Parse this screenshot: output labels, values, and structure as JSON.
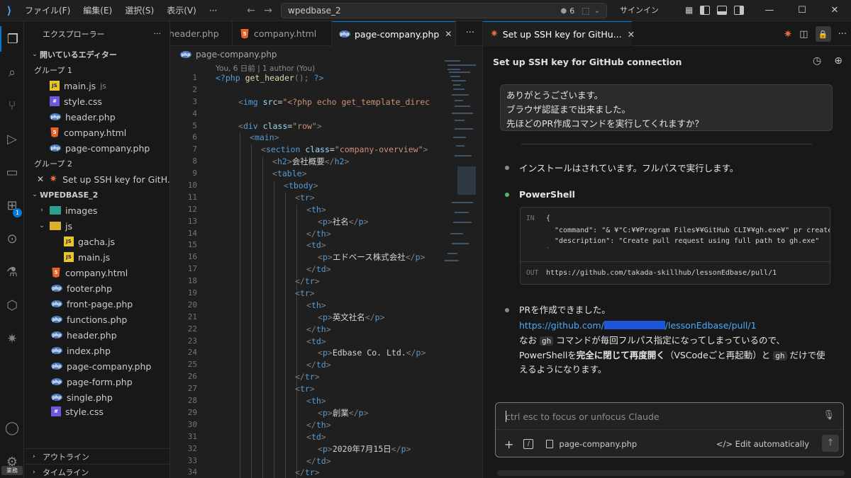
{
  "titlebar": {
    "menus": [
      "ファイル(F)",
      "編集(E)",
      "選択(S)",
      "表示(V)",
      "···"
    ],
    "search_text": "wpedbase_2",
    "badge_count": "6",
    "signin": "サインイン"
  },
  "activity": {
    "badge": "1",
    "account_label": "業務"
  },
  "sidebar": {
    "title": "エクスプローラー",
    "more": "···",
    "open_editors_label": "開いているエディター",
    "group1_label": "グループ 1",
    "group1": [
      {
        "name": "main.js",
        "extra": "js",
        "type": "js"
      },
      {
        "name": "style.css",
        "extra": "",
        "type": "css"
      },
      {
        "name": "header.php",
        "extra": "",
        "type": "php"
      },
      {
        "name": "company.html",
        "extra": "",
        "type": "html"
      },
      {
        "name": "page-company.php",
        "extra": "",
        "type": "php"
      }
    ],
    "group2_label": "グループ 2",
    "group2_item": "Set up SSH key for GitH...",
    "project_label": "WPEDBASE_2",
    "tree": [
      {
        "name": "images",
        "type": "folder"
      },
      {
        "name": "js",
        "type": "folder-js"
      },
      {
        "name": "gacha.js",
        "type": "js"
      },
      {
        "name": "main.js",
        "type": "js"
      },
      {
        "name": "company.html",
        "type": "html"
      },
      {
        "name": "footer.php",
        "type": "php"
      },
      {
        "name": "front-page.php",
        "type": "php"
      },
      {
        "name": "functions.php",
        "type": "php"
      },
      {
        "name": "header.php",
        "type": "php"
      },
      {
        "name": "index.php",
        "type": "php"
      },
      {
        "name": "page-company.php",
        "type": "php"
      },
      {
        "name": "page-form.php",
        "type": "php"
      },
      {
        "name": "single.php",
        "type": "php"
      },
      {
        "name": "style.css",
        "type": "css"
      }
    ],
    "outline_label": "アウトライン",
    "timeline_label": "タイムライン"
  },
  "editor": {
    "tabs": [
      "header.php",
      "company.html",
      "page-company.php"
    ],
    "breadcrumb": "page-company.php",
    "codelens": "You, 6 日前 | 1 author (You)",
    "line_numbers": [
      "1",
      "2",
      "3",
      "4",
      "5",
      "6",
      "7",
      "8",
      "9",
      "10",
      "11",
      "12",
      "13",
      "14",
      "15",
      "16",
      "17",
      "18",
      "19",
      "20",
      "21",
      "22",
      "23",
      "24",
      "25",
      "26",
      "27",
      "28",
      "29",
      "30",
      "31",
      "32",
      "33",
      "34"
    ],
    "code_text": {
      "l1": "get_header",
      "l3a": "img",
      "l3b": "src",
      "l3c": "\"<?php echo get_template_direc",
      "l5a": "div",
      "l5b": "class",
      "l5c": "\"row\"",
      "l6": "main",
      "l7a": "section",
      "l7b": "class",
      "l7c": "\"company-overview\"",
      "l8": "会社概要",
      "l9": "table",
      "l10": "tbody",
      "l11": "tr",
      "l12": "th",
      "l13a": "p",
      "l13b": "社名",
      "l14": "th",
      "l15": "td",
      "l16a": "p",
      "l16b": "エドベース株式会社",
      "l17": "td",
      "l18": "tr",
      "l19": "tr",
      "l20": "th",
      "l21a": "p",
      "l21b": "英文社名",
      "l22": "th",
      "l23": "td",
      "l24a": "p",
      "l24b": "Edbase Co. Ltd.",
      "l25": "td",
      "l26": "tr",
      "l27": "tr",
      "l28": "th",
      "l29a": "p",
      "l29b": "創業",
      "l30": "th",
      "l31": "td",
      "l32a": "p",
      "l32b": "2020年7月15日",
      "l33": "td",
      "l34": "tr"
    }
  },
  "panel": {
    "tab_title": "Set up SSH key for GitHu...",
    "title": "Set up SSH key for GitHub connection",
    "user_message": [
      "ありがとうございます。",
      "ブラウザ認証まで出来ました。",
      "先ほどのPR作成コマンドを実行してくれますか？"
    ],
    "msg1": "インストールはされています。フルパスで実行します。",
    "tool_name": "PowerShell",
    "in_label": "IN",
    "out_label": "OUT",
    "in_lines": [
      "{",
      "\"command\": \"& ¥\"C:¥¥Program Files¥¥GitHub CLI¥¥gh.exe¥\" pr create --ti",
      "\"description\": \"Create pull request using full path to gh.exe\"",
      "`"
    ],
    "out_line": "https://github.com/takada-skillhub/lessonEdbase/pull/1",
    "msg2": "PRを作成できました。",
    "link_prefix": "https://github.com/",
    "link_suffix": "/lessonEdbase/pull/1",
    "note_1": "なお",
    "note_code": "gh",
    "note_2": "コマンドが毎回フルパス指定になってしまっているので、",
    "note_3a": "PowerShellを",
    "note_3b": "完全に閉じて再度開く",
    "note_3c": "（VSCodeごと再起動）と",
    "note_3d": "だけで使",
    "note_4": "えるようになります。",
    "input_placeholder": "ctrl esc to focus or unfocus Claude",
    "attached_file": "page-company.php",
    "edit_mode": "Edit automatically"
  },
  "colors": {
    "accent": "#0078d4",
    "claude": "#e46e44",
    "link": "#4daafc"
  }
}
